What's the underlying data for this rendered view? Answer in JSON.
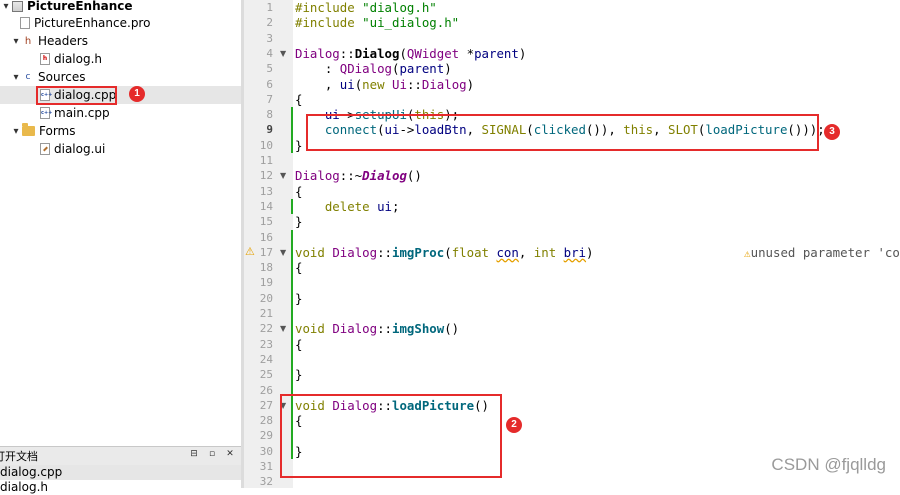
{
  "tree": {
    "project": "PictureEnhance",
    "pro_file": "PictureEnhance.pro",
    "headers_label": "Headers",
    "header_file": "dialog.h",
    "sources_label": "Sources",
    "source_file_1": "dialog.cpp",
    "source_file_2": "main.cpp",
    "forms_label": "Forms",
    "form_file": "dialog.ui",
    "badge_1": "1"
  },
  "open_docs": {
    "title": "打开文档",
    "doc_1": "dialog.cpp",
    "doc_2": "dialog.h"
  },
  "editor": {
    "line_numbers": [
      "1",
      "2",
      "3",
      "4",
      "5",
      "6",
      "7",
      "8",
      "9",
      "10",
      "11",
      "12",
      "13",
      "14",
      "15",
      "16",
      "17",
      "18",
      "19",
      "20",
      "21",
      "22",
      "23",
      "24",
      "25",
      "26",
      "27",
      "28",
      "29",
      "30",
      "31",
      "32"
    ],
    "current_line": "9",
    "warning_text": "unused parameter 'co",
    "badge_2": "2",
    "badge_3": "3"
  },
  "watermark": "CSDN @fjqlldg",
  "colors": {
    "annotation_red": "#e52b2b",
    "keyword": "#808000",
    "string": "#008000",
    "type": "#800080",
    "modified_bar": "#22aa22",
    "warning": "#e5a000"
  }
}
